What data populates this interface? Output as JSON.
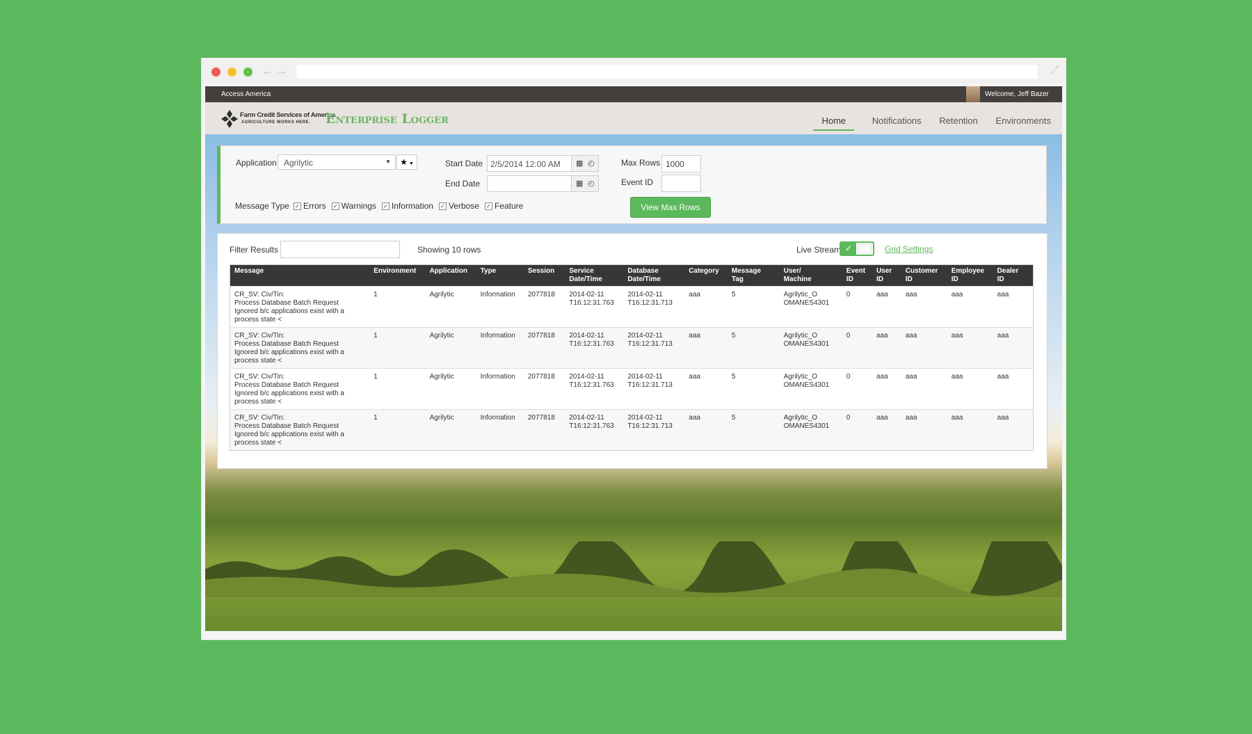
{
  "topbar": {
    "brand": "Access America",
    "welcome": "Welcome, Jeff Bazer"
  },
  "header": {
    "logo_line1": "Farm Credit Services of America",
    "logo_line2": "AGRICULTURE WORKS HERE.",
    "app_title": "Enterprise Logger",
    "nav": [
      "Home",
      "Notifications",
      "Retention",
      "Environments"
    ]
  },
  "search": {
    "application_label": "Application",
    "application_value": "Agrilytic",
    "start_date_label": "Start Date",
    "start_date_value": "2/5/2014 12:00 AM",
    "end_date_label": "End Date",
    "end_date_value": "",
    "max_rows_label": "Max Rows",
    "max_rows_value": "1000",
    "event_id_label": "Event ID",
    "event_id_value": "",
    "message_type_label": "Message Type",
    "message_types": [
      "Errors",
      "Warnings",
      "Information",
      "Verbose",
      "Feature"
    ],
    "view_button": "View Max Rows"
  },
  "results": {
    "filter_label": "Filter Results",
    "filter_value": "",
    "showing": "Showing 10 rows",
    "live_stream_label": "Live Stream",
    "live_stream_on": true,
    "grid_settings": "Grid Settings",
    "columns": [
      "Message",
      "Environment",
      "Application",
      "Type",
      "Session",
      "Service\nDate/Time",
      "Database\nDate/Time",
      "Category",
      "Message\nTag",
      "User/\nMachine",
      "Event\nID",
      "User\nID",
      "Customer\nID",
      "Employee\nID",
      "Dealer\nID"
    ],
    "rows": [
      [
        "CR_SV:        Civ/Tin:\nProcess Database Batch Request\nIgnored b/c applications exist with a\nprocess state <",
        "1",
        "Agrilytic",
        "Information",
        "2077818",
        "2014-02-11\nT16:12:31.763",
        "2014-02-11\nT16:12:31.713",
        "aaa",
        "5",
        "Agrilytic_O\nOMANES4301",
        "0",
        "aaa",
        "aaa",
        "aaa",
        "aaa"
      ],
      [
        "CR_SV:        Civ/Tin:\nProcess Database Batch Request\nIgnored b/c applications exist with a\nprocess state <",
        "1",
        "Agrilytic",
        "Information",
        "2077818",
        "2014-02-11\nT16:12:31.763",
        "2014-02-11\nT16:12:31.713",
        "aaa",
        "5",
        "Agrilytic_O\nOMANES4301",
        "0",
        "aaa",
        "aaa",
        "aaa",
        "aaa"
      ],
      [
        "CR_SV:        Civ/Tin:\nProcess Database Batch Request\nIgnored b/c applications exist with a\nprocess state <",
        "1",
        "Agrilytic",
        "Information",
        "2077818",
        "2014-02-11\nT16:12:31.763",
        "2014-02-11\nT16:12:31.713",
        "aaa",
        "5",
        "Agrilytic_O\nOMANES4301",
        "0",
        "aaa",
        "aaa",
        "aaa",
        "aaa"
      ],
      [
        "CR_SV:        Civ/Tin:\nProcess Database Batch Request\nIgnored b/c applications exist with a\nprocess state <",
        "1",
        "Agrilytic",
        "Information",
        "2077818",
        "2014-02-11\nT16:12:31.763",
        "2014-02-11\nT16:12:31.713",
        "aaa",
        "5",
        "Agrilytic_O\nOMANES4301",
        "0",
        "aaa",
        "aaa",
        "aaa",
        "aaa"
      ]
    ]
  },
  "colors": {
    "accent": "#5cb85c",
    "topbar": "#433f3d",
    "table_header": "#393636"
  }
}
